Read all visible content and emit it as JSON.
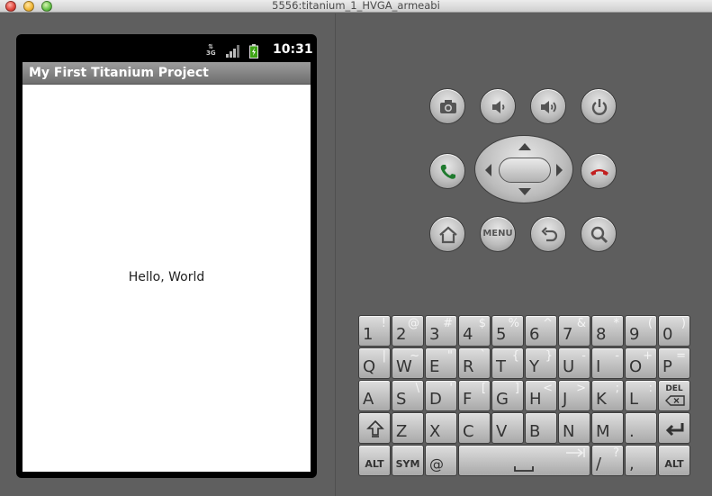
{
  "window": {
    "title": "5556:titanium_1_HVGA_armeabi"
  },
  "status_bar": {
    "network": "3G",
    "time": "10:31"
  },
  "app": {
    "title": "My First Titanium Project",
    "label": "Hello, World"
  },
  "controls": {
    "menu_label": "MENU"
  },
  "keyboard": {
    "row1": [
      {
        "main": "1",
        "alt": "!"
      },
      {
        "main": "2",
        "alt": "@"
      },
      {
        "main": "3",
        "alt": "#"
      },
      {
        "main": "4",
        "alt": "$"
      },
      {
        "main": "5",
        "alt": "%"
      },
      {
        "main": "6",
        "alt": "^"
      },
      {
        "main": "7",
        "alt": "&"
      },
      {
        "main": "8",
        "alt": "*"
      },
      {
        "main": "9",
        "alt": "("
      },
      {
        "main": "0",
        "alt": ")"
      }
    ],
    "row2": [
      {
        "main": "Q",
        "alt": "|"
      },
      {
        "main": "W",
        "alt": "~"
      },
      {
        "main": "E",
        "alt": "\""
      },
      {
        "main": "R",
        "alt": "`"
      },
      {
        "main": "T",
        "alt": "{"
      },
      {
        "main": "Y",
        "alt": "}"
      },
      {
        "main": "U",
        "alt": "-"
      },
      {
        "main": "I",
        "alt": "-"
      },
      {
        "main": "O",
        "alt": "+"
      },
      {
        "main": "P",
        "alt": "="
      }
    ],
    "row3": [
      {
        "main": "A",
        "alt": ""
      },
      {
        "main": "S",
        "alt": "\\"
      },
      {
        "main": "D",
        "alt": "'"
      },
      {
        "main": "F",
        "alt": "["
      },
      {
        "main": "G",
        "alt": "]"
      },
      {
        "main": "H",
        "alt": "<"
      },
      {
        "main": "J",
        "alt": ">"
      },
      {
        "main": "K",
        "alt": ";"
      },
      {
        "main": "L",
        "alt": ":"
      }
    ],
    "del_label": "DEL",
    "row4": [
      {
        "main": "Z",
        "alt": ""
      },
      {
        "main": "X",
        "alt": ""
      },
      {
        "main": "C",
        "alt": ""
      },
      {
        "main": "V",
        "alt": ""
      },
      {
        "main": "B",
        "alt": ""
      },
      {
        "main": "N",
        "alt": ""
      },
      {
        "main": "M",
        "alt": ""
      },
      {
        "main": ".",
        "alt": ""
      }
    ],
    "alt_label": "ALT",
    "sym_label": "SYM",
    "at_label": "@",
    "slash_label": "/",
    "slash_alt": "?",
    "comma_label": ","
  }
}
